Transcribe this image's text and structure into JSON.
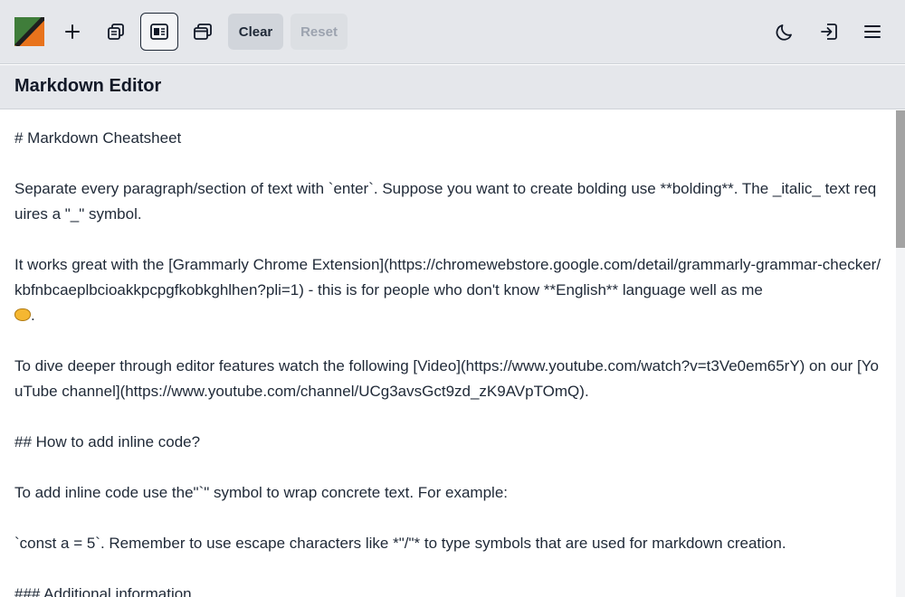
{
  "toolbar": {
    "clear_label": "Clear",
    "reset_label": "Reset",
    "icons": [
      "logo",
      "plus-icon",
      "copy-icon",
      "split-view-icon",
      "window-icon",
      "moon-icon",
      "login-icon",
      "menu-icon"
    ]
  },
  "panel": {
    "title": "Markdown Editor"
  },
  "editor": {
    "lines": [
      "# Markdown Cheatsheet",
      "",
      "Separate every paragraph/section of text with `enter`. Suppose you want to create bolding use **bolding**. The _italic_ text requires a \"_\" symbol.",
      "",
      "It works great with the [Grammarly Chrome Extension](https://chromewebstore.google.com/detail/grammarly-grammar-checker/kbfnbcaeplbcioakkpcpgfkobkghlhen?pli=1) - this is for people who don't know **English** language well as me",
      ".",
      "",
      "To dive deeper through editor features watch the following [Video](https://www.youtube.com/watch?v=t3Ve0em65rY) on our [YouTube channel](https://www.youtube.com/channel/UCg3avsGct9zd_zK9AVpTOmQ).",
      "",
      "## How to add inline code?",
      "",
      "To add inline code use the\"`\" symbol to wrap concrete text. For example:",
      "",
      "`const a = 5`. Remember to use escape characters like *\"/\"* to type symbols that are used for markdown creation.",
      "",
      "### Additional information"
    ]
  },
  "colors": {
    "toolbar_bg": "#e5e7eb",
    "logo_green": "#3f7d3a",
    "logo_orange": "#e8731c",
    "logo_dark": "#1f1f1f"
  }
}
